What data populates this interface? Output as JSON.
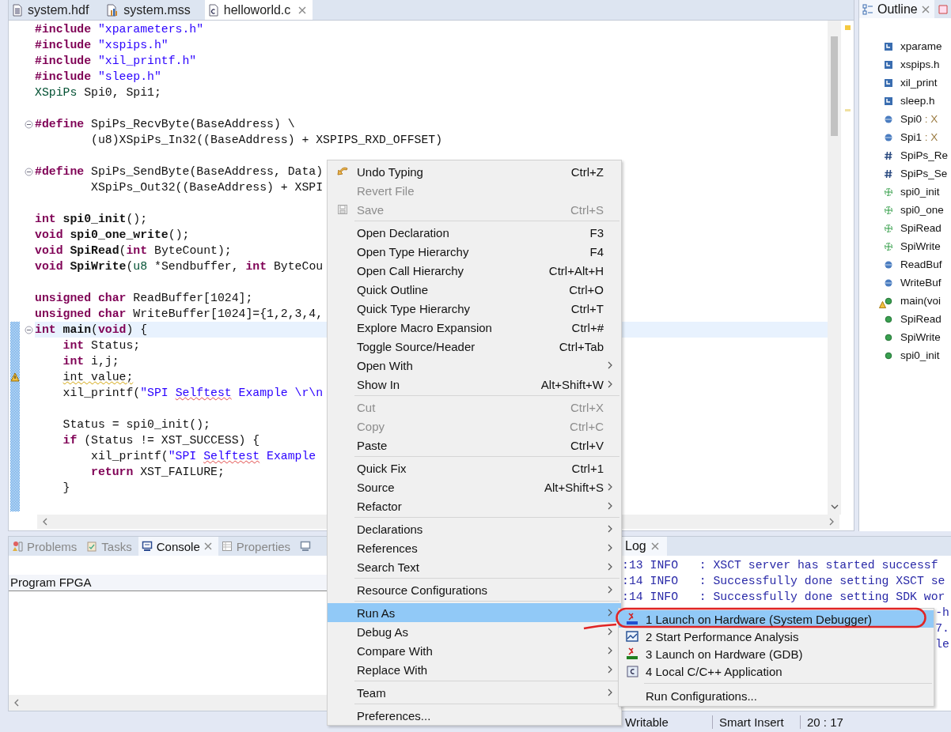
{
  "editor": {
    "tabs": [
      {
        "kind": "hdf",
        "label": "system.hdf",
        "selected": false
      },
      {
        "kind": "mss",
        "label": "system.mss",
        "selected": false
      },
      {
        "kind": "c",
        "label": "helloworld.c",
        "selected": true
      }
    ],
    "lines": [
      {
        "fold": false,
        "current": false,
        "changed": false,
        "warning": false,
        "tokens": [
          {
            "kind": "directive",
            "text": "#include"
          },
          {
            "kind": "string",
            "text": " \"xparameters.h\""
          }
        ]
      },
      {
        "fold": false,
        "current": false,
        "changed": false,
        "warning": false,
        "tokens": [
          {
            "kind": "directive",
            "text": "#include"
          },
          {
            "kind": "string",
            "text": " \"xspips.h\""
          }
        ]
      },
      {
        "fold": false,
        "current": false,
        "changed": false,
        "warning": false,
        "tokens": [
          {
            "kind": "directive",
            "text": "#include"
          },
          {
            "kind": "string",
            "text": " \"xil_printf.h\""
          }
        ]
      },
      {
        "fold": false,
        "current": false,
        "changed": false,
        "warning": false,
        "tokens": [
          {
            "kind": "directive",
            "text": "#include"
          },
          {
            "kind": "string",
            "text": " \"sleep.h\""
          }
        ]
      },
      {
        "fold": false,
        "current": false,
        "changed": false,
        "warning": false,
        "tokens": [
          {
            "kind": "type",
            "text": "XSpiPs"
          },
          {
            "kind": "plain",
            "text": " Spi0, Spi1;"
          }
        ]
      },
      {
        "fold": false,
        "current": false,
        "changed": false,
        "warning": false
      },
      {
        "fold": true,
        "current": false,
        "changed": false,
        "warning": false,
        "tokens": [
          {
            "kind": "directive",
            "text": "#define"
          },
          {
            "kind": "plain",
            "text": " SpiPs_RecvByte(BaseAddress) \\"
          }
        ]
      },
      {
        "fold": false,
        "current": false,
        "changed": false,
        "warning": false,
        "tokens": [
          {
            "kind": "plain",
            "text": "        (u8)XSpiPs_In32((BaseAddress) + XSPIPS_RXD_OFFSET)"
          }
        ]
      },
      {
        "fold": false,
        "current": false,
        "changed": false,
        "warning": false
      },
      {
        "fold": true,
        "current": false,
        "changed": false,
        "warning": false,
        "tokens": [
          {
            "kind": "directive",
            "text": "#define"
          },
          {
            "kind": "plain",
            "text": " SpiPs_SendByte(BaseAddress, Data)"
          }
        ]
      },
      {
        "fold": false,
        "current": false,
        "changed": false,
        "warning": false,
        "tokens": [
          {
            "kind": "plain",
            "text": "        XSpiPs_Out32((BaseAddress) + XSPI"
          }
        ]
      },
      {
        "fold": false,
        "current": false,
        "changed": false,
        "warning": false
      },
      {
        "fold": false,
        "current": false,
        "changed": false,
        "warning": false,
        "tokens": [
          {
            "kind": "keyword",
            "text": "int"
          },
          {
            "kind": "decl",
            "text": " spi0_init"
          },
          {
            "kind": "plain",
            "text": "();"
          }
        ]
      },
      {
        "fold": false,
        "current": false,
        "changed": false,
        "warning": false,
        "tokens": [
          {
            "kind": "keyword",
            "text": "void"
          },
          {
            "kind": "decl",
            "text": " spi0_one_write"
          },
          {
            "kind": "plain",
            "text": "();"
          }
        ]
      },
      {
        "fold": false,
        "current": false,
        "changed": false,
        "warning": false,
        "tokens": [
          {
            "kind": "keyword",
            "text": "void"
          },
          {
            "kind": "decl",
            "text": " SpiRead"
          },
          {
            "kind": "plain",
            "text": "("
          },
          {
            "kind": "keyword",
            "text": "int"
          },
          {
            "kind": "plain",
            "text": " ByteCount);"
          }
        ]
      },
      {
        "fold": false,
        "current": false,
        "changed": false,
        "warning": false,
        "tokens": [
          {
            "kind": "keyword",
            "text": "void"
          },
          {
            "kind": "decl",
            "text": " SpiWrite"
          },
          {
            "kind": "plain",
            "text": "("
          },
          {
            "kind": "type",
            "text": "u8"
          },
          {
            "kind": "plain",
            "text": " *Sendbuffer, "
          },
          {
            "kind": "keyword",
            "text": "int"
          },
          {
            "kind": "plain",
            "text": " ByteCou"
          }
        ]
      },
      {
        "fold": false,
        "current": false,
        "changed": false,
        "warning": false
      },
      {
        "fold": false,
        "current": false,
        "changed": false,
        "warning": false,
        "tokens": [
          {
            "kind": "keyword",
            "text": "unsigned char"
          },
          {
            "kind": "plain",
            "text": " ReadBuffer[1024];"
          }
        ]
      },
      {
        "fold": false,
        "current": false,
        "changed": false,
        "warning": false,
        "tokens": [
          {
            "kind": "keyword",
            "text": "unsigned char"
          },
          {
            "kind": "plain",
            "text": " WriteBuffer[1024]={1,2,3,4,"
          }
        ]
      },
      {
        "fold": true,
        "current": true,
        "changed": true,
        "warning": false,
        "tokens": [
          {
            "kind": "keyword",
            "text": "int"
          },
          {
            "kind": "decl",
            "text": " main"
          },
          {
            "kind": "plain",
            "text": "("
          },
          {
            "kind": "keyword",
            "text": "void"
          },
          {
            "kind": "plain",
            "text": ") {"
          }
        ]
      },
      {
        "fold": false,
        "current": false,
        "changed": true,
        "warning": false,
        "tokens": [
          {
            "kind": "keyword",
            "text": "    int"
          },
          {
            "kind": "plain",
            "text": " Status;"
          }
        ]
      },
      {
        "fold": false,
        "current": false,
        "changed": true,
        "warning": false,
        "tokens": [
          {
            "kind": "keyword",
            "text": "    int"
          },
          {
            "kind": "plain",
            "text": " i,j;"
          }
        ]
      },
      {
        "fold": false,
        "current": false,
        "changed": true,
        "warning": true,
        "tokens": [
          {
            "kind": "warned",
            "text": "    int value;"
          }
        ]
      },
      {
        "fold": false,
        "current": false,
        "changed": true,
        "warning": false,
        "tokens": [
          {
            "kind": "plain",
            "text": "    xil_printf("
          },
          {
            "kind": "string",
            "text": "\"SPI "
          },
          {
            "kind": "misspelled",
            "text": "Selftest"
          },
          {
            "kind": "string",
            "text": " Example \\r\\n"
          }
        ]
      },
      {
        "fold": false,
        "current": false,
        "changed": true,
        "warning": false
      },
      {
        "fold": false,
        "current": false,
        "changed": true,
        "warning": false,
        "tokens": [
          {
            "kind": "plain",
            "text": "    Status = spi0_init();"
          }
        ]
      },
      {
        "fold": false,
        "current": false,
        "changed": true,
        "warning": false,
        "tokens": [
          {
            "kind": "keyword",
            "text": "    if"
          },
          {
            "kind": "plain",
            "text": " (Status != XST_SUCCESS) {"
          }
        ]
      },
      {
        "fold": false,
        "current": false,
        "changed": true,
        "warning": false,
        "tokens": [
          {
            "kind": "plain",
            "text": "        xil_printf("
          },
          {
            "kind": "string",
            "text": "\"SPI "
          },
          {
            "kind": "misspelled",
            "text": "Selftest"
          },
          {
            "kind": "string",
            "text": " Example"
          }
        ]
      },
      {
        "fold": false,
        "current": false,
        "changed": true,
        "warning": false,
        "tokens": [
          {
            "kind": "keyword",
            "text": "        return"
          },
          {
            "kind": "plain",
            "text": " XST_FAILURE;"
          }
        ]
      },
      {
        "fold": false,
        "current": false,
        "changed": true,
        "warning": false,
        "tokens": [
          {
            "kind": "plain",
            "text": "    }"
          }
        ]
      },
      {
        "fold": false,
        "current": false,
        "changed": true,
        "warning": false
      }
    ]
  },
  "outline": {
    "title": "Outline",
    "items": [
      {
        "kind": "include",
        "label": "xparame",
        "warning": false
      },
      {
        "kind": "include",
        "label": "xspips.h",
        "warning": false
      },
      {
        "kind": "include",
        "label": "xil_print",
        "warning": false
      },
      {
        "kind": "include",
        "label": "sleep.h",
        "warning": false
      },
      {
        "kind": "variable",
        "label": "Spi0",
        "type": ": X",
        "warning": false
      },
      {
        "kind": "variable",
        "label": "Spi1",
        "type": ": X",
        "warning": false
      },
      {
        "kind": "macro",
        "label": "SpiPs_Re",
        "warning": false
      },
      {
        "kind": "macro",
        "label": "SpiPs_Se",
        "warning": false
      },
      {
        "kind": "prototype",
        "label": "spi0_init",
        "warning": false
      },
      {
        "kind": "prototype",
        "label": "spi0_one",
        "warning": false
      },
      {
        "kind": "prototype",
        "label": "SpiRead",
        "warning": false
      },
      {
        "kind": "prototype",
        "label": "SpiWrite",
        "warning": false
      },
      {
        "kind": "variable",
        "label": "ReadBuf",
        "warning": false
      },
      {
        "kind": "variable",
        "label": "WriteBuf",
        "warning": false
      },
      {
        "kind": "function",
        "label": "main(voi",
        "warning": true
      },
      {
        "kind": "function",
        "label": "SpiRead",
        "warning": false
      },
      {
        "kind": "function",
        "label": "SpiWrite",
        "warning": false
      },
      {
        "kind": "function",
        "label": "spi0_init",
        "warning": false
      }
    ]
  },
  "bottom_tabs": [
    {
      "kind": "problems",
      "label": "Problems",
      "selected": false
    },
    {
      "kind": "tasks",
      "label": "Tasks",
      "selected": false
    },
    {
      "kind": "console",
      "label": "Console",
      "selected": true
    },
    {
      "kind": "properties",
      "label": "Properties",
      "selected": false
    }
  ],
  "console": {
    "header": "Program FPGA"
  },
  "log": {
    "tab": "Log",
    "lines": [
      {
        "kind": "full",
        "text": ":13 INFO   : XSCT server has started successf"
      },
      {
        "kind": "full",
        "text": ":14 INFO   : Successfully done setting XSCT se"
      },
      {
        "kind": "full",
        "text": ":14 INFO   : Successfully done setting SDK wor"
      },
      {
        "kind": "tail",
        "text": "-h"
      },
      {
        "kind": "tail",
        "text": "7."
      },
      {
        "kind": "tail",
        "text": "le"
      }
    ]
  },
  "context_menu": [
    {
      "kind": "item",
      "label": "Undo Typing",
      "shortcut": "Ctrl+Z",
      "disabled": false,
      "submenu": false,
      "selected": false
    },
    {
      "kind": "item",
      "label": "Revert File",
      "disabled": true,
      "submenu": false,
      "selected": false
    },
    {
      "kind": "item",
      "label": "Save",
      "shortcut": "Ctrl+S",
      "disabled": true,
      "submenu": false,
      "selected": false
    },
    {
      "kind": "separator"
    },
    {
      "kind": "item",
      "label": "Open Declaration",
      "shortcut": "F3",
      "disabled": false,
      "submenu": false,
      "selected": false
    },
    {
      "kind": "item",
      "label": "Open Type Hierarchy",
      "shortcut": "F4",
      "disabled": false,
      "submenu": false,
      "selected": false
    },
    {
      "kind": "item",
      "label": "Open Call Hierarchy",
      "shortcut": "Ctrl+Alt+H",
      "disabled": false,
      "submenu": false,
      "selected": false
    },
    {
      "kind": "item",
      "label": "Quick Outline",
      "shortcut": "Ctrl+O",
      "disabled": false,
      "submenu": false,
      "selected": false
    },
    {
      "kind": "item",
      "label": "Quick Type Hierarchy",
      "shortcut": "Ctrl+T",
      "disabled": false,
      "submenu": false,
      "selected": false
    },
    {
      "kind": "item",
      "label": "Explore Macro Expansion",
      "shortcut": "Ctrl+#",
      "disabled": false,
      "submenu": false,
      "selected": false
    },
    {
      "kind": "item",
      "label": "Toggle Source/Header",
      "shortcut": "Ctrl+Tab",
      "disabled": false,
      "submenu": false,
      "selected": false
    },
    {
      "kind": "item",
      "label": "Open With",
      "disabled": false,
      "submenu": true,
      "selected": false
    },
    {
      "kind": "item",
      "label": "Show In",
      "shortcut": "Alt+Shift+W",
      "disabled": false,
      "submenu": true,
      "selected": false
    },
    {
      "kind": "separator"
    },
    {
      "kind": "item",
      "label": "Cut",
      "shortcut": "Ctrl+X",
      "disabled": true,
      "submenu": false,
      "selected": false
    },
    {
      "kind": "item",
      "label": "Copy",
      "shortcut": "Ctrl+C",
      "disabled": true,
      "submenu": false,
      "selected": false
    },
    {
      "kind": "item",
      "label": "Paste",
      "shortcut": "Ctrl+V",
      "disabled": false,
      "submenu": false,
      "selected": false
    },
    {
      "kind": "separator"
    },
    {
      "kind": "item",
      "label": "Quick Fix",
      "shortcut": "Ctrl+1",
      "disabled": false,
      "submenu": false,
      "selected": false
    },
    {
      "kind": "item",
      "label": "Source",
      "shortcut": "Alt+Shift+S",
      "disabled": false,
      "submenu": true,
      "selected": false
    },
    {
      "kind": "item",
      "label": "Refactor",
      "disabled": false,
      "submenu": true,
      "selected": false
    },
    {
      "kind": "separator"
    },
    {
      "kind": "item",
      "label": "Declarations",
      "disabled": false,
      "submenu": true,
      "selected": false
    },
    {
      "kind": "item",
      "label": "References",
      "disabled": false,
      "submenu": true,
      "selected": false
    },
    {
      "kind": "item",
      "label": "Search Text",
      "disabled": false,
      "submenu": true,
      "selected": false
    },
    {
      "kind": "separator"
    },
    {
      "kind": "item",
      "label": "Resource Configurations",
      "disabled": false,
      "submenu": true,
      "selected": false
    },
    {
      "kind": "separator"
    },
    {
      "kind": "item",
      "label": "Run As",
      "disabled": false,
      "submenu": true,
      "selected": true
    },
    {
      "kind": "item",
      "label": "Debug As",
      "disabled": false,
      "submenu": true,
      "selected": false
    },
    {
      "kind": "item",
      "label": "Compare With",
      "disabled": false,
      "submenu": true,
      "selected": false
    },
    {
      "kind": "item",
      "label": "Replace With",
      "disabled": false,
      "submenu": true,
      "selected": false
    },
    {
      "kind": "separator"
    },
    {
      "kind": "item",
      "label": "Team",
      "disabled": false,
      "submenu": true,
      "selected": false
    },
    {
      "kind": "separator"
    },
    {
      "kind": "item",
      "label": "Preferences...",
      "disabled": false,
      "submenu": false,
      "selected": false
    }
  ],
  "run_as_menu": [
    {
      "kind": "tcf",
      "label": "1 Launch on Hardware (System Debugger)",
      "selected": true
    },
    {
      "kind": "perf",
      "label": "2 Start Performance Analysis",
      "selected": false
    },
    {
      "kind": "gdb",
      "label": "3 Launch on Hardware (GDB)",
      "selected": false
    },
    {
      "kind": "local",
      "label": "4 Local C/C++ Application",
      "selected": false
    },
    {
      "kind": "separator"
    },
    {
      "kind": "plain",
      "label": "Run Configurations...",
      "selected": false
    }
  ],
  "status_bar": [
    "Writable",
    "Smart Insert",
    "20 : 17"
  ]
}
